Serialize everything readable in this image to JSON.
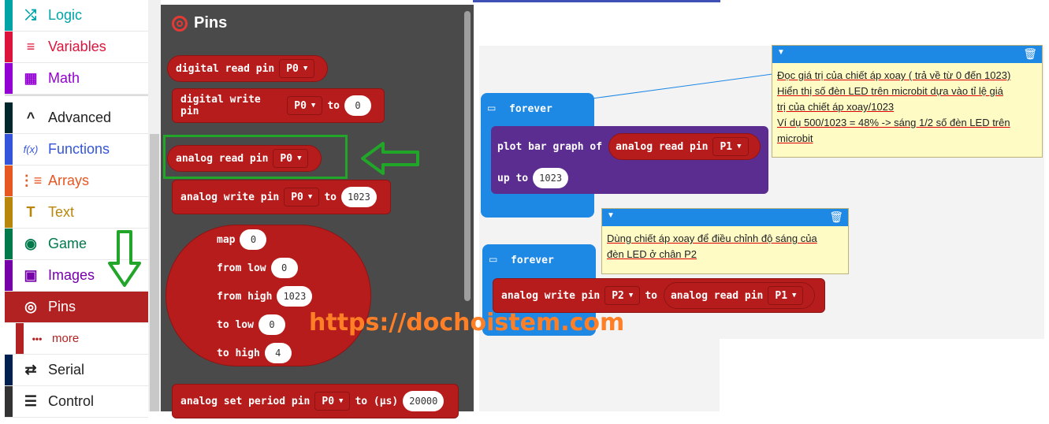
{
  "categories": [
    {
      "label": "Logic",
      "color": "#00a4a6",
      "icon": "⤮"
    },
    {
      "label": "Variables",
      "color": "#dc143c",
      "icon": "≡"
    },
    {
      "label": "Math",
      "color": "#9400d3",
      "icon": "▦"
    },
    {
      "label": "Advanced",
      "color": "#00272b",
      "icon": "^"
    },
    {
      "label": "Functions",
      "color": "#3455db",
      "icon": "f(x)"
    },
    {
      "label": "Arrays",
      "color": "#e65722",
      "icon": "⋮≡"
    },
    {
      "label": "Text",
      "color": "#b8860b",
      "icon": "T"
    },
    {
      "label": "Game",
      "color": "#007a4b",
      "icon": "◉"
    },
    {
      "label": "Images",
      "color": "#7600a8",
      "icon": "▣"
    },
    {
      "label": "Pins",
      "color": "#b22222",
      "icon": "◎"
    },
    {
      "label": "more",
      "color": "#b22222",
      "icon": "•••"
    },
    {
      "label": "Serial",
      "color": "#002050",
      "icon": "⇄"
    },
    {
      "label": "Control",
      "color": "#333333",
      "icon": "☰"
    }
  ],
  "flyout": {
    "title": "Pins",
    "digital_read": {
      "label": "digital read pin",
      "pin": "P0"
    },
    "digital_write": {
      "label": "digital write pin",
      "pin": "P0",
      "to": "to",
      "value": "0"
    },
    "analog_read": {
      "label": "analog read pin",
      "pin": "P0"
    },
    "analog_write": {
      "label": "analog write pin",
      "pin": "P0",
      "to": "to",
      "value": "1023"
    },
    "map": {
      "map": "map",
      "map_v": "0",
      "from_low": "from low",
      "from_low_v": "0",
      "from_high": "from high",
      "from_high_v": "1023",
      "to_low": "to low",
      "to_low_v": "0",
      "to_high": "to high",
      "to_high_v": "4"
    },
    "analog_period": {
      "label": "analog set period pin",
      "pin": "P0",
      "to": "to (µs)",
      "value": "20000"
    }
  },
  "workspace": {
    "forever1": "forever",
    "plot": {
      "label": "plot bar graph of",
      "read": "analog read pin",
      "pin": "P1",
      "upto": "up to",
      "value": "1023"
    },
    "comment1": {
      "l1": "Đọc giá trị của chiết áp xoay ( trả về từ 0 đến 1023)",
      "l2": "Hiển thị số đèn LED trên microbit dựa vào tỉ lệ giá",
      "l3": "trị của chiết áp xoay/1023",
      "l4": "Ví dụ 500/1023 = 48% -> sáng 1/2 số đèn LED trên",
      "l5": "microbit"
    },
    "forever2": "forever",
    "awrite": {
      "label": "analog write pin",
      "pin": "P2",
      "to": "to",
      "read": "analog read pin",
      "pin2": "P1"
    },
    "comment2": {
      "l1": "Dùng chiết áp xoay để điều chỉnh độ sáng của",
      "l2": "đèn LED ở chân P2"
    }
  },
  "watermark": "https://dochoistem.com",
  "colors": {
    "pins": "#b71c1c",
    "loops": "#1e88e5",
    "led": "#5c2d91",
    "highlight": "#21a629"
  }
}
